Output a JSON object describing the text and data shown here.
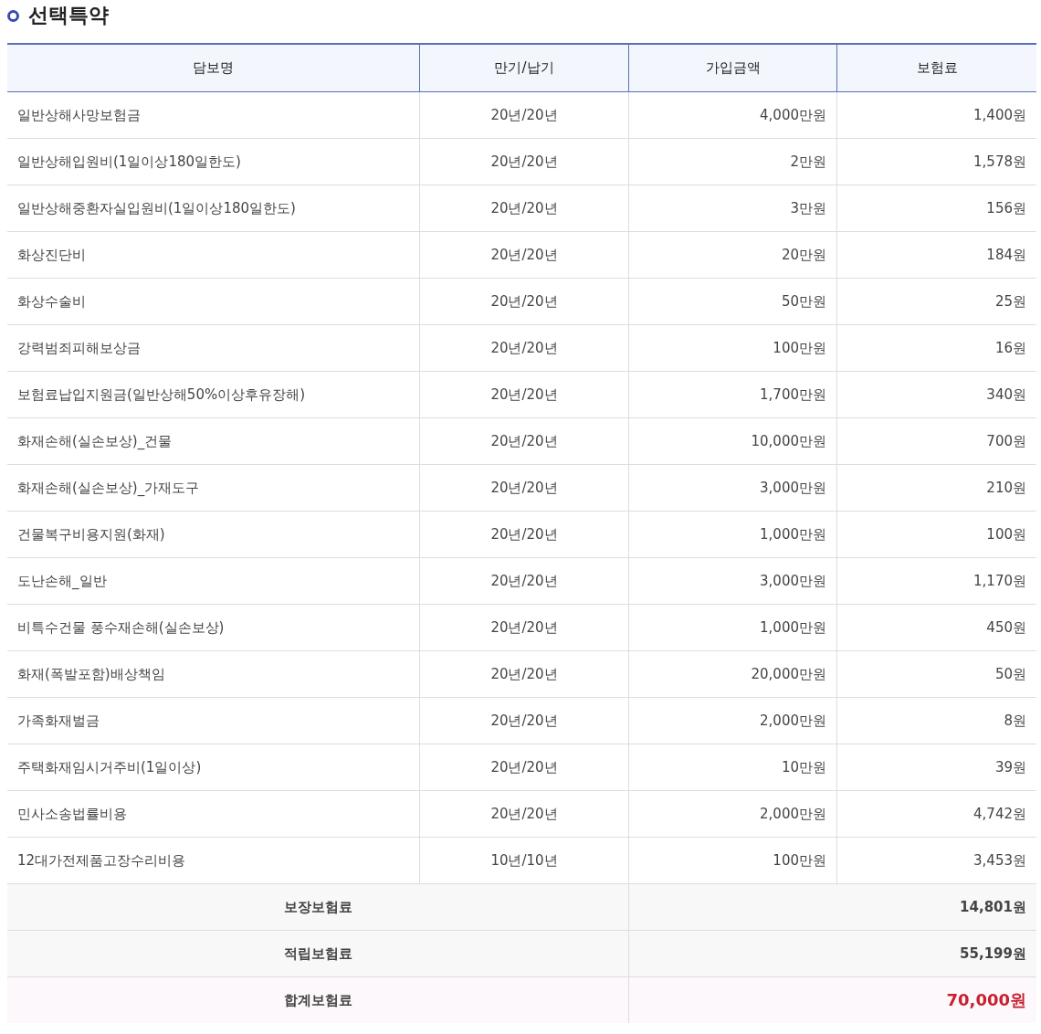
{
  "section_title": "선택특약",
  "table": {
    "columns": [
      "담보명",
      "만기/납기",
      "가입금액",
      "보험료"
    ],
    "rows": [
      [
        "일반상해사망보험금",
        "20년/20년",
        "4,000만원",
        "1,400원"
      ],
      [
        "일반상해입원비(1일이상180일한도)",
        "20년/20년",
        "2만원",
        "1,578원"
      ],
      [
        "일반상해중환자실입원비(1일이상180일한도)",
        "20년/20년",
        "3만원",
        "156원"
      ],
      [
        "화상진단비",
        "20년/20년",
        "20만원",
        "184원"
      ],
      [
        "화상수술비",
        "20년/20년",
        "50만원",
        "25원"
      ],
      [
        "강력범죄피해보상금",
        "20년/20년",
        "100만원",
        "16원"
      ],
      [
        "보험료납입지원금(일반상해50%이상후유장해)",
        "20년/20년",
        "1,700만원",
        "340원"
      ],
      [
        "화재손해(실손보상)_건물",
        "20년/20년",
        "10,000만원",
        "700원"
      ],
      [
        "화재손해(실손보상)_가재도구",
        "20년/20년",
        "3,000만원",
        "210원"
      ],
      [
        "건물복구비용지원(화재)",
        "20년/20년",
        "1,000만원",
        "100원"
      ],
      [
        "도난손해_일반",
        "20년/20년",
        "3,000만원",
        "1,170원"
      ],
      [
        "비특수건물 풍수재손해(실손보상)",
        "20년/20년",
        "1,000만원",
        "450원"
      ],
      [
        "화재(폭발포함)배상책임",
        "20년/20년",
        "20,000만원",
        "50원"
      ],
      [
        "가족화재벌금",
        "20년/20년",
        "2,000만원",
        "8원"
      ],
      [
        "주택화재임시거주비(1일이상)",
        "20년/20년",
        "10만원",
        "39원"
      ],
      [
        "민사소송법률비용",
        "20년/20년",
        "2,000만원",
        "4,742원"
      ],
      [
        "12대가전제품고장수리비용",
        "10년/10년",
        "100만원",
        "3,453원"
      ]
    ],
    "summary": [
      {
        "kind": "subtotal",
        "label": "보장보험료",
        "value": "14,801원"
      },
      {
        "kind": "subtotal",
        "label": "적립보험료",
        "value": "55,199원"
      },
      {
        "kind": "total",
        "label": "합계보험료",
        "value": "70,000원"
      }
    ]
  }
}
